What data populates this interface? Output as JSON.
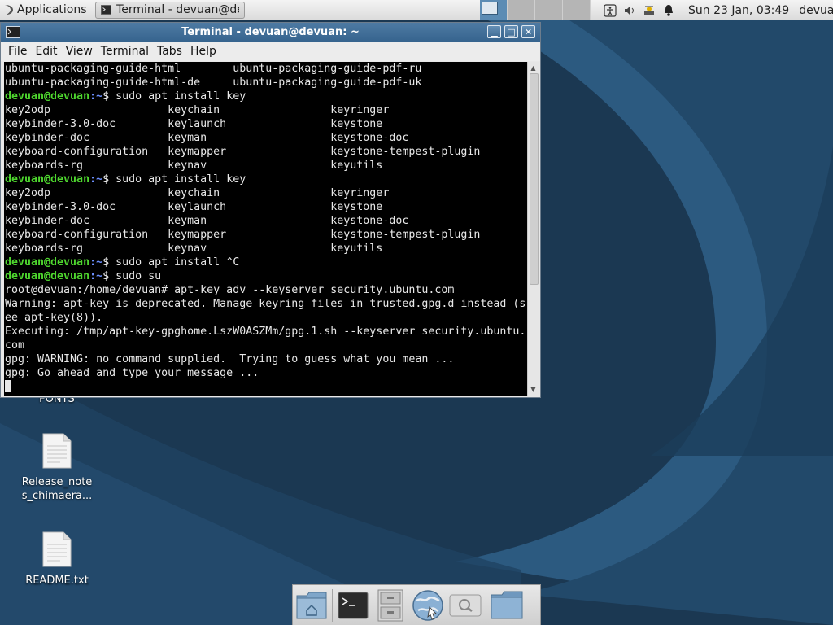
{
  "panel": {
    "applications_label": "Applications",
    "taskbar_item_label": "Terminal - devuan@dev...",
    "clock": "Sun 23 Jan, 03:49",
    "user": "devuan"
  },
  "terminal": {
    "title": "Terminal - devuan@devuan: ~",
    "menu": [
      "File",
      "Edit",
      "View",
      "Terminal",
      "Tabs",
      "Help"
    ],
    "prompt_user": "devuan@devuan",
    "prompt_path": ":~",
    "lines": [
      {
        "type": "out",
        "text": "ubuntu-packaging-guide-html        ubuntu-packaging-guide-pdf-ru"
      },
      {
        "type": "out",
        "text": "ubuntu-packaging-guide-html-de     ubuntu-packaging-guide-pdf-uk"
      },
      {
        "type": "prompt",
        "text": "$ sudo apt install key"
      },
      {
        "type": "out",
        "text": "key2odp                  keychain                 keyringer"
      },
      {
        "type": "out",
        "text": "keybinder-3.0-doc        keylaunch                keystone"
      },
      {
        "type": "out",
        "text": "keybinder-doc            keyman                   keystone-doc"
      },
      {
        "type": "out",
        "text": "keyboard-configuration   keymapper                keystone-tempest-plugin"
      },
      {
        "type": "out",
        "text": "keyboards-rg             keynav                   keyutils"
      },
      {
        "type": "prompt",
        "text": "$ sudo apt install key"
      },
      {
        "type": "out",
        "text": "key2odp                  keychain                 keyringer"
      },
      {
        "type": "out",
        "text": "keybinder-3.0-doc        keylaunch                keystone"
      },
      {
        "type": "out",
        "text": "keybinder-doc            keyman                   keystone-doc"
      },
      {
        "type": "out",
        "text": "keyboard-configuration   keymapper                keystone-tempest-plugin"
      },
      {
        "type": "out",
        "text": "keyboards-rg             keynav                   keyutils"
      },
      {
        "type": "prompt",
        "text": "$ sudo apt install ^C"
      },
      {
        "type": "prompt",
        "text": "$ sudo su"
      },
      {
        "type": "out",
        "text": "root@devuan:/home/devuan# apt-key adv --keyserver security.ubuntu.com"
      },
      {
        "type": "out",
        "text": "Warning: apt-key is deprecated. Manage keyring files in trusted.gpg.d instead (s"
      },
      {
        "type": "out",
        "text": "ee apt-key(8))."
      },
      {
        "type": "out",
        "text": "Executing: /tmp/apt-key-gpghome.LszW0ASZMm/gpg.1.sh --keyserver security.ubuntu."
      },
      {
        "type": "out",
        "text": "com"
      },
      {
        "type": "out",
        "text": "gpg: WARNING: no command supplied.  Trying to guess what you mean ..."
      },
      {
        "type": "out",
        "text": "gpg: Go ahead and type your message ..."
      },
      {
        "type": "cursor",
        "text": ""
      }
    ]
  },
  "desktop": {
    "icons": [
      {
        "label_line1": "FONTS",
        "label_line2": ""
      },
      {
        "label_line1": "Release_note",
        "label_line2": "s_chimaera..."
      },
      {
        "label_line1": "README.txt",
        "label_line2": ""
      }
    ]
  },
  "dock": {
    "items": [
      "home-folder-icon",
      "terminal-icon",
      "file-cabinet-icon",
      "web-browser-icon",
      "search-icon",
      "folder-icon"
    ]
  },
  "colors": {
    "prompt_user": "#4ed62e",
    "prompt_path": "#6c8fff",
    "titlebar": "#36648e",
    "wallpaper_dark": "#1b3a54",
    "wallpaper_light": "#2e5f86"
  }
}
